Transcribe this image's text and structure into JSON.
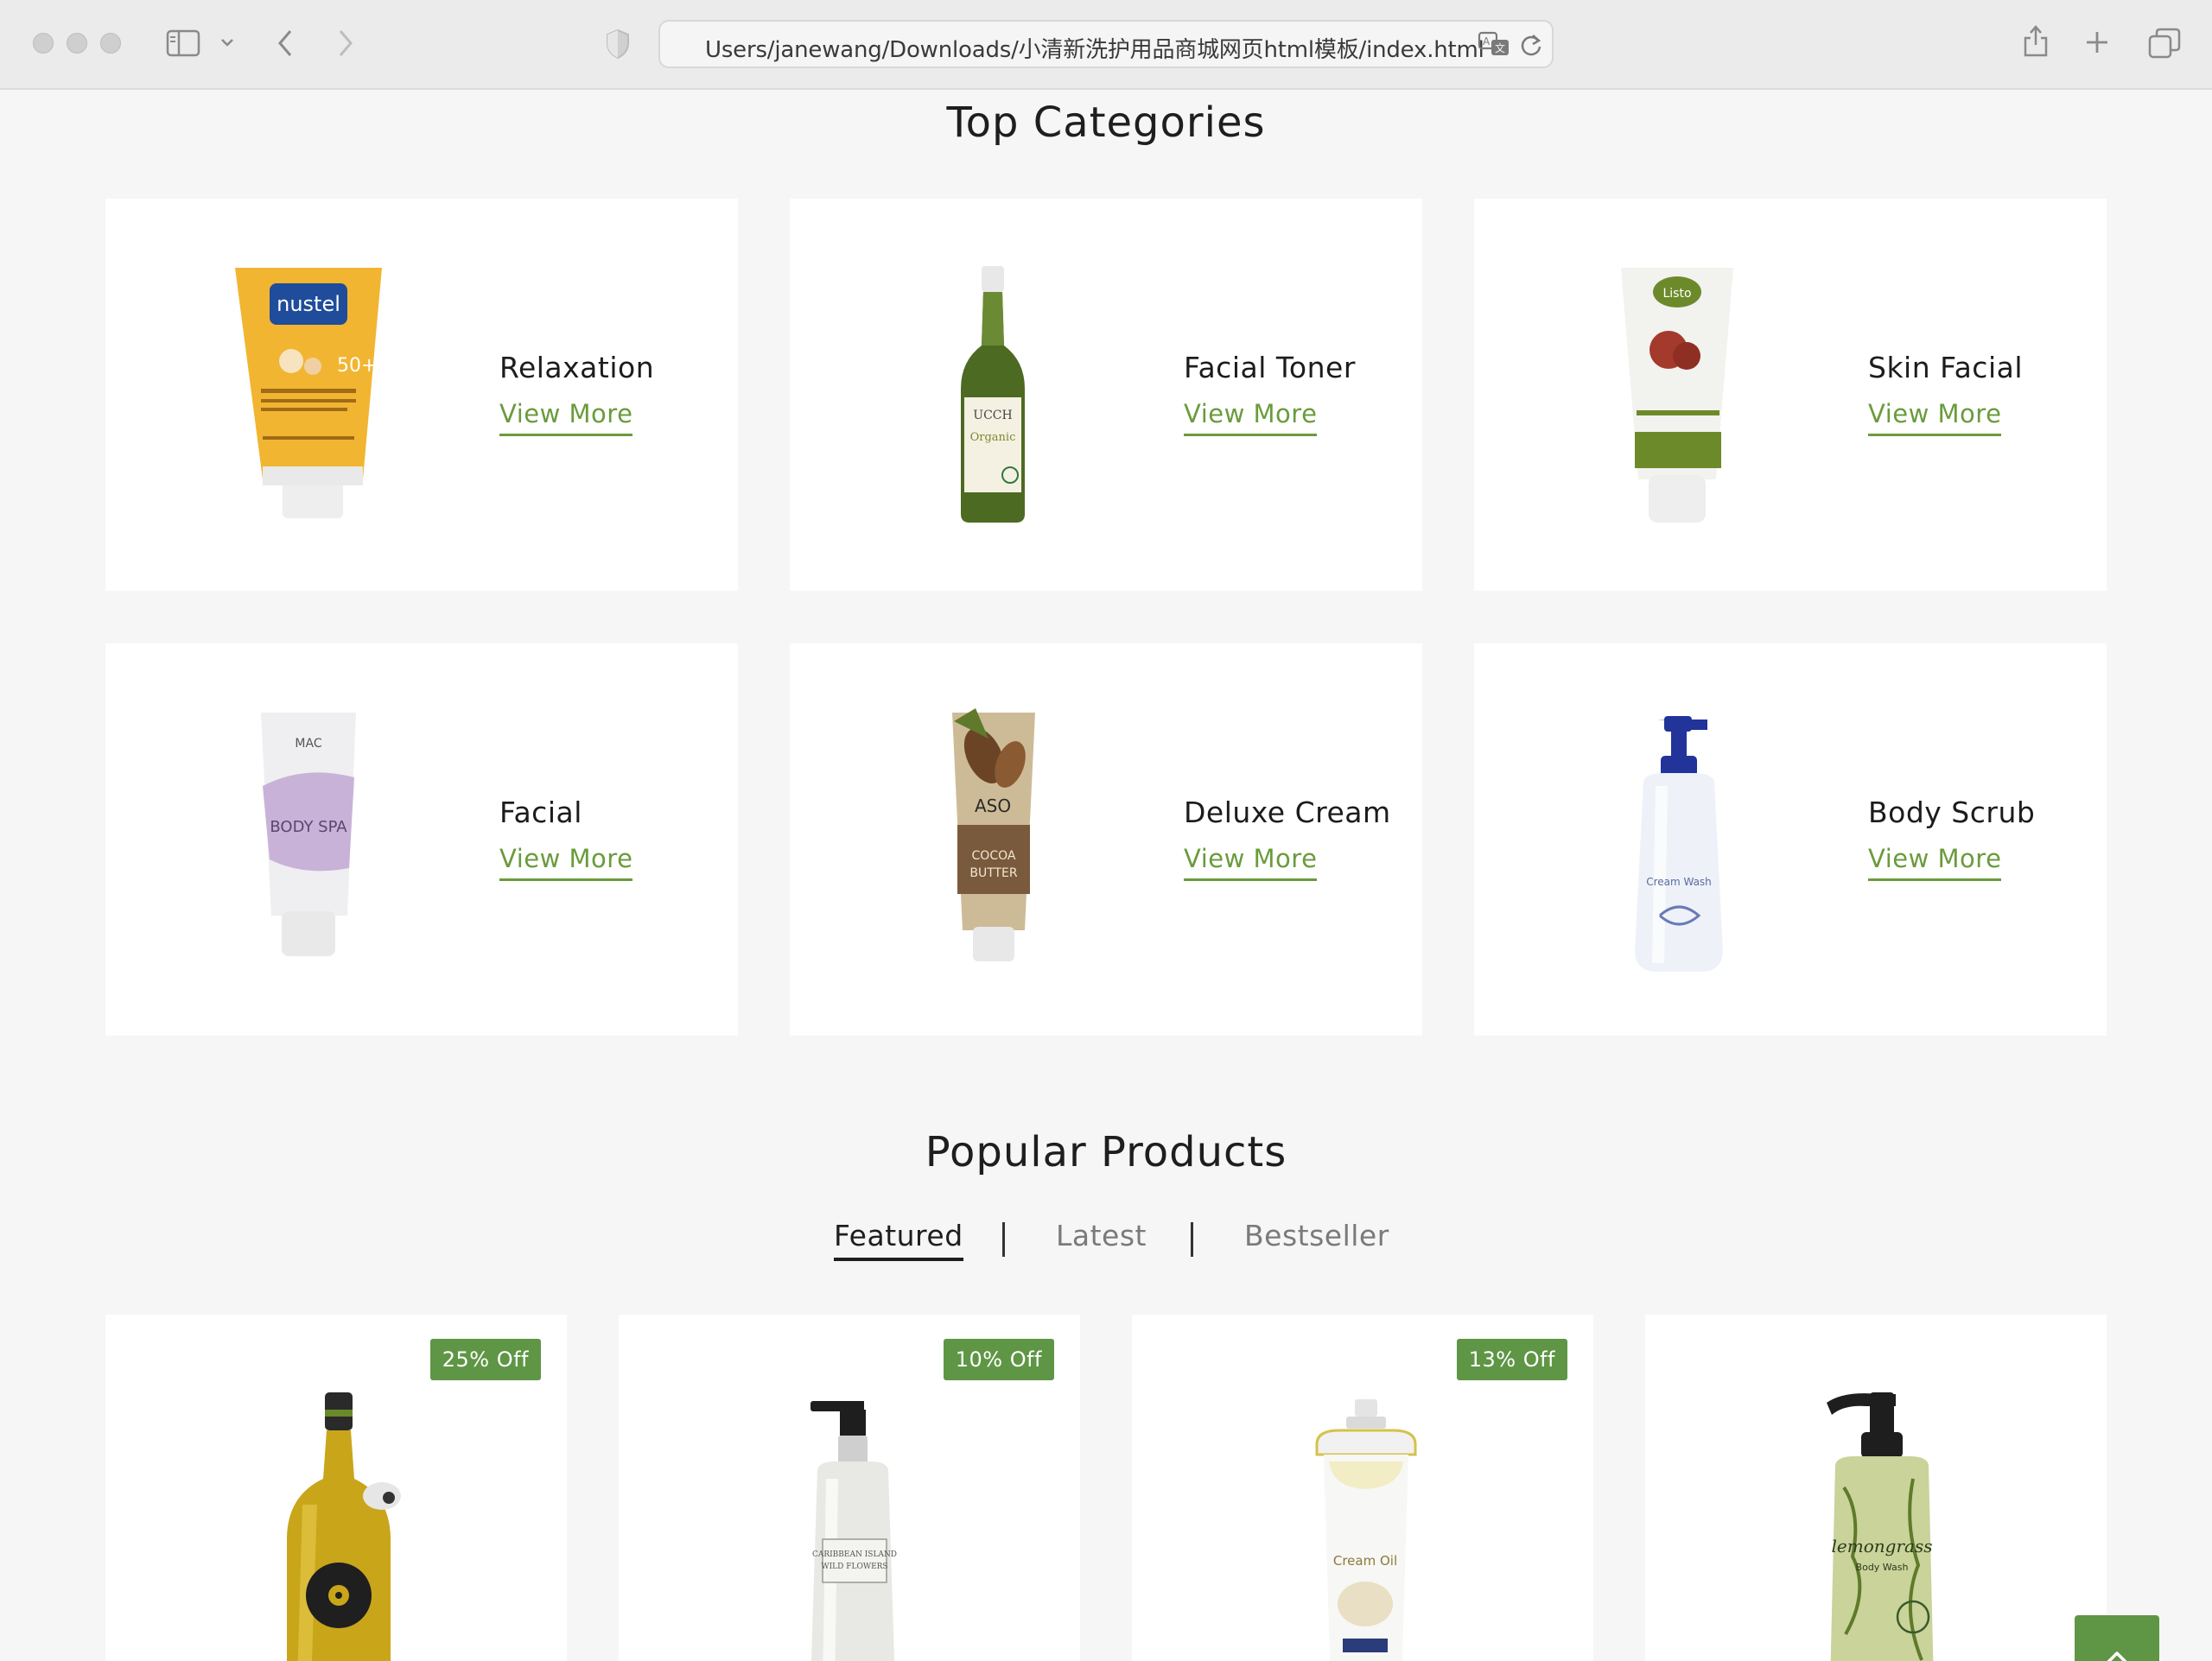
{
  "browser": {
    "url": "Users/janewang/Downloads/小清新洗护用品商城网页html模板/index.html"
  },
  "categories_section": {
    "title": "Top Categories",
    "items": [
      {
        "name": "Relaxation",
        "link": "View More",
        "icon": "sunscreen-tube"
      },
      {
        "name": "Facial Toner",
        "link": "View More",
        "icon": "oil-bottle"
      },
      {
        "name": "Skin Facial",
        "link": "View More",
        "icon": "cream-tube"
      },
      {
        "name": "Facial",
        "link": "View More",
        "icon": "body-spa-tube"
      },
      {
        "name": "Deluxe Cream",
        "link": "View More",
        "icon": "cocoa-butter-tube"
      },
      {
        "name": "Body Scrub",
        "link": "View More",
        "icon": "pump-bottle"
      }
    ]
  },
  "products_section": {
    "title": "Popular Products",
    "tabs": [
      {
        "label": "Featured",
        "active": true
      },
      {
        "label": "Latest",
        "active": false
      },
      {
        "label": "Bestseller",
        "active": false
      }
    ],
    "products": [
      {
        "badge": "25% Off",
        "icon": "olive-oil-bottle"
      },
      {
        "badge": "10% Off",
        "icon": "lotion-pump-bottle"
      },
      {
        "badge": "13% Off",
        "icon": "cream-oil-bottle"
      },
      {
        "badge": "",
        "icon": "lemongrass-body-wash"
      }
    ]
  },
  "colors": {
    "accent": "#5f9646",
    "link": "#6a9b3c",
    "background": "#f6f6f6"
  }
}
